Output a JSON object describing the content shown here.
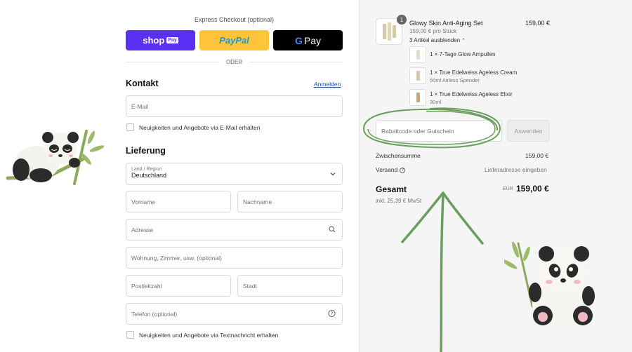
{
  "express": {
    "title": "Express Checkout (optional)",
    "shop_label": "shop",
    "shop_badge": "Pay",
    "paypal_pay": "Pay",
    "paypal_pal": "Pal",
    "gpay_g": "G",
    "gpay_label": "Pay",
    "divider": "ODER"
  },
  "contact": {
    "heading": "Kontakt",
    "login_link": "Anmelden",
    "email_placeholder": "E-Mail",
    "newsletter_label": "Neuigkeiten und Angebote via E-Mail erhalten"
  },
  "delivery": {
    "heading": "Lieferung",
    "country_label": "Land / Region",
    "country_value": "Deutschland",
    "first_name": "Vorname",
    "last_name": "Nachname",
    "address": "Adresse",
    "apartment": "Wohnung, Zimmer, usw. (optional)",
    "zip": "Postleitzahl",
    "city": "Stadt",
    "phone": "Telefon (optional)",
    "sms_label": "Neuigkeiten und Angebote via Textnachricht erhalten"
  },
  "cart": {
    "product": {
      "quantity": "1",
      "name": "Glowy Skin Anti-Aging Set",
      "unit_price": "159,00 € pro Stück",
      "price": "159,00 €",
      "toggle": "3 Artikel ausblenden"
    },
    "items": [
      {
        "name": "1 × 7-Tage Glow Ampullen",
        "detail": ""
      },
      {
        "name": "1 × True Edelweiss Ageless Cream",
        "detail": "50ml Airless Spender"
      },
      {
        "name": "1 × True Edelweiss Ageless Elixir",
        "detail": "30ml"
      }
    ],
    "discount_placeholder": "Rabattcode oder Gutschein",
    "apply_label": "Anwenden",
    "subtotal_label": "Zwischensumme",
    "subtotal_value": "159,00 €",
    "shipping_label": "Versand",
    "shipping_value": "Lieferadresse eingeben",
    "total_label": "Gesamt",
    "currency": "EUR",
    "total_value": "159,00 €",
    "tax_note": "inkl. 25,39 € MwSt"
  },
  "colors": {
    "shop_pay": "#5a31f4",
    "paypal": "#ffc439",
    "gpay": "#000000",
    "annotation_green": "#6a9e5c",
    "link": "#1a4fa0"
  }
}
